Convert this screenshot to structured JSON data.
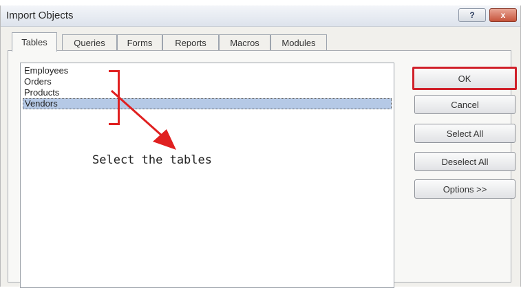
{
  "window": {
    "title": "Import Objects"
  },
  "titlebar": {
    "help_glyph": "?",
    "close_glyph": "x"
  },
  "tabs": [
    {
      "label": "Tables",
      "active": true
    },
    {
      "label": "Queries"
    },
    {
      "label": "Forms"
    },
    {
      "label": "Reports"
    },
    {
      "label": "Macros"
    },
    {
      "label": "Modules"
    }
  ],
  "list": {
    "items": [
      "Employees",
      "Orders",
      "Products",
      "Vendors"
    ],
    "selected": "Vendors"
  },
  "annotation": {
    "text": "Select the tables",
    "color": "#e02020"
  },
  "buttons": {
    "ok": "OK",
    "cancel": "Cancel",
    "select_all": "Select All",
    "deselect_all": "Deselect All",
    "options": "Options >>"
  },
  "colors": {
    "highlight": "#d0202a",
    "selection": "#b5c9e6"
  }
}
